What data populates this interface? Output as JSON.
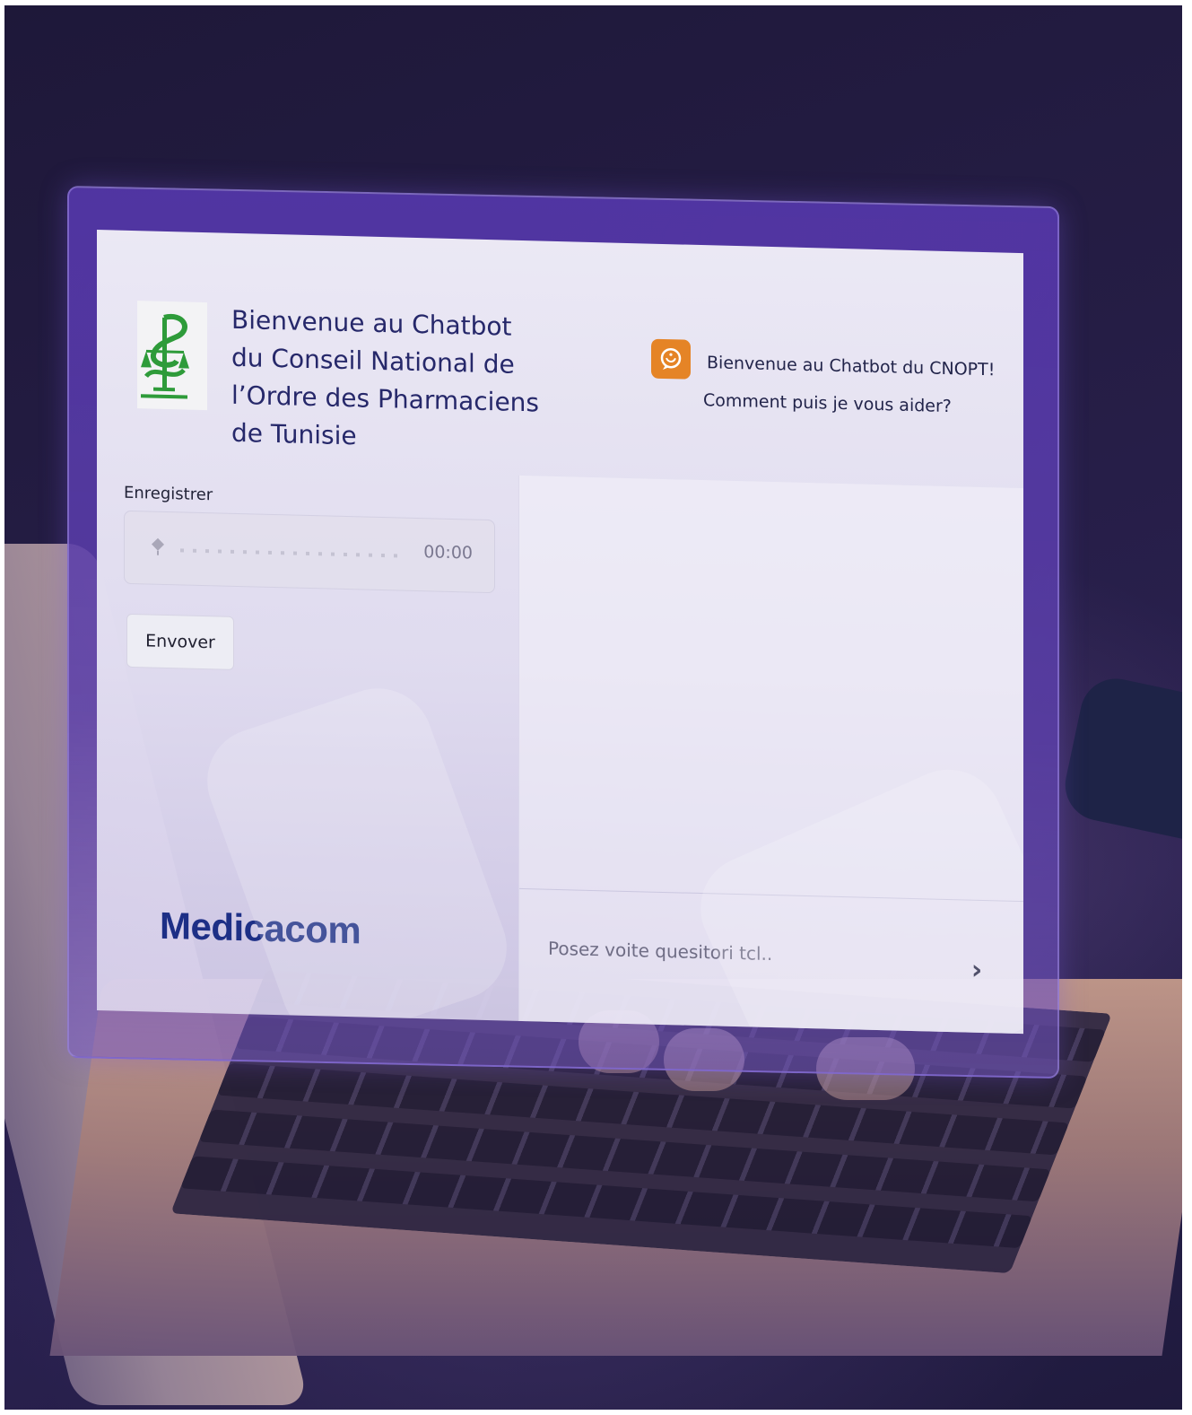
{
  "header": {
    "title_lines": [
      "Bienvenue au Chatbot",
      "du Conseil National de",
      "l’Ordre des Pharmaciens",
      "de Tunisie"
    ],
    "logo_icon": "pharmacy-caduceus-icon"
  },
  "bot": {
    "icon": "chat-bubble-icon",
    "greeting_lines": [
      "Bienvenue au Chatbot du CNOPT!",
      "Comment puis je vous aider?"
    ]
  },
  "recorder": {
    "label": "Enregistrer",
    "time": "00:00",
    "mic_icon": "microphone-icon",
    "send_label": "Envover"
  },
  "chat": {
    "placeholder": "Posez voite quesitori tcl..",
    "send_icon": "chevron-right-icon"
  },
  "brand": {
    "name": "Medicacom"
  },
  "colors": {
    "frame": "#5537aa",
    "accent_orange": "#e58426",
    "title_navy": "#26286a",
    "logo_green": "#2e9b3a",
    "brand_blue": "#1d2f86"
  }
}
